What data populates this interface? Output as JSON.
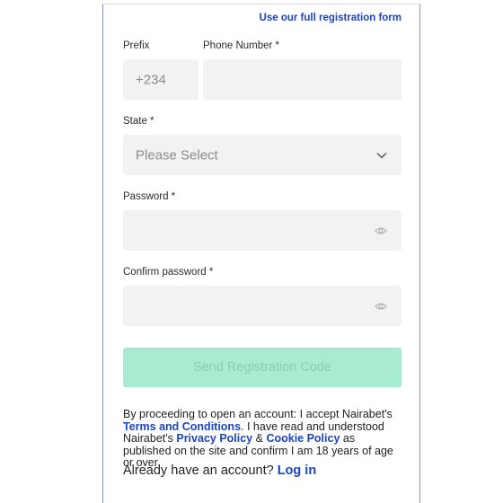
{
  "form": {
    "full_registration_link": "Use our full registration form",
    "prefix_label": "Prefix",
    "prefix_value": "+234",
    "phone_label": "Phone Number *",
    "state_label": "State *",
    "state_selected": "Please Select",
    "password_label": "Password *",
    "confirm_password_label": "Confirm password *",
    "send_button": "Send Registration Code",
    "legal": {
      "part1": "By proceeding to open an account: I accept Nairabet's ",
      "terms_link": "Terms and Conditions",
      "part2": ". I have read and understood Nairabet's ",
      "privacy_link": "Privacy Policy",
      "part3": " & ",
      "cookie_link": "Cookie Policy",
      "part4": " as published on the site and confirm I am 18 years of age or over."
    },
    "login_prompt": "Already have an account? ",
    "login_link": "Log in"
  },
  "icons": {
    "state_dropdown": "chevron-down-icon",
    "password_toggle": "eye-icon",
    "confirm_password_toggle": "eye-icon"
  },
  "colors": {
    "link": "#1a43c6",
    "send_button_bg": "#a7ecd1",
    "field_bg": "#f2f2f2"
  }
}
